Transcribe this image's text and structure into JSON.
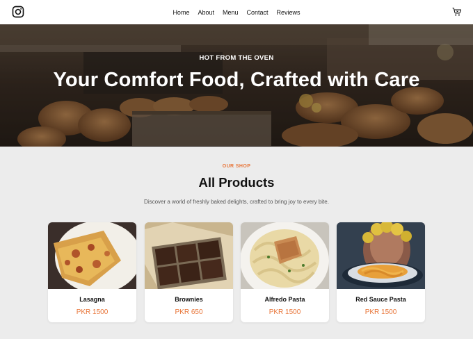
{
  "nav": {
    "items": [
      "Home",
      "About",
      "Menu",
      "Contact",
      "Reviews"
    ]
  },
  "icons": {
    "social": "instagram-icon",
    "cart": "shopping-cart-icon"
  },
  "hero": {
    "kicker": "HOT FROM THE OVEN",
    "title": "Your Comfort Food, Crafted with Care"
  },
  "shop": {
    "kicker": "OUR SHOP",
    "title": "All Products",
    "subtitle": "Discover a world of freshly baked delights, crafted to bring joy to every bite."
  },
  "products": [
    {
      "name": "Lasagna",
      "price": "PKR 1500"
    },
    {
      "name": "Brownies",
      "price": "PKR 650"
    },
    {
      "name": "Alfredo Pasta",
      "price": "PKR 1500"
    },
    {
      "name": "Red Sauce Pasta",
      "price": "PKR 1500"
    }
  ],
  "colors": {
    "accent": "#e8763a",
    "background": "#ececec",
    "header": "#ffffff"
  }
}
